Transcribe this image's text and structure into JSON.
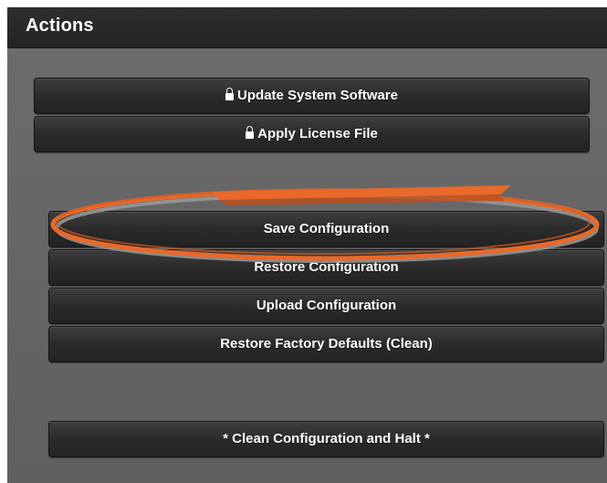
{
  "panel": {
    "title": "Actions"
  },
  "buttons": {
    "update_system_software": "Update System Software",
    "apply_license_file": "Apply License File",
    "save_configuration": "Save Configuration",
    "restore_configuration": "Restore Configuration",
    "upload_configuration": "Upload Configuration",
    "restore_factory_defaults": "Restore Factory Defaults (Clean)",
    "clean_configuration_and_halt": "* Clean Configuration and Halt *"
  },
  "icons": {
    "locked_action": "lock-icon"
  },
  "colors": {
    "header_bg": "#2a2a2a",
    "panel_bg": "#636363",
    "button_bg": "#2c2c2c",
    "button_text": "#ffffff",
    "annotation_orange": "#e8692a"
  }
}
